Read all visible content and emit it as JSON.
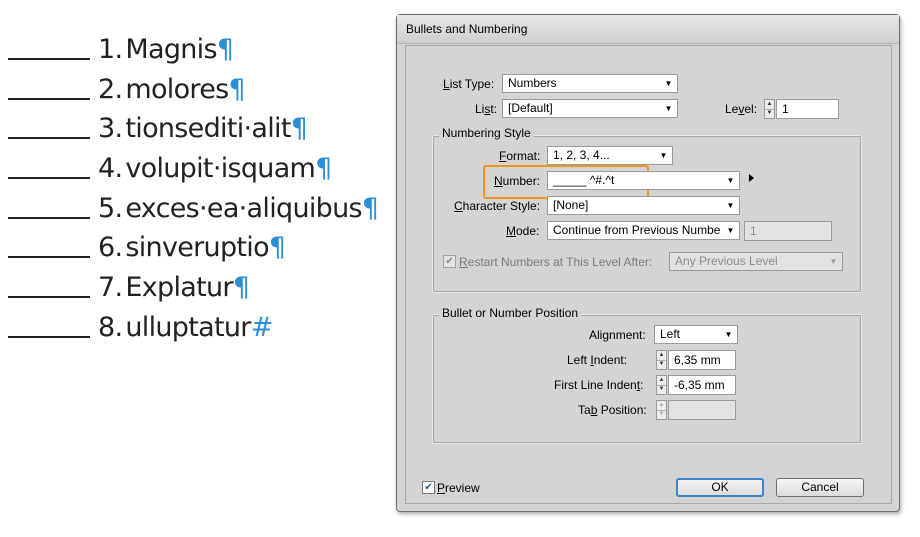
{
  "list": {
    "items": [
      {
        "number": "1.",
        "text": "Magnis",
        "end_mark": "¶"
      },
      {
        "number": "2.",
        "text": "molores",
        "end_mark": "¶"
      },
      {
        "number": "3.",
        "text": "tionsediti·alit",
        "end_mark": "¶"
      },
      {
        "number": "4.",
        "text": "volupit·isquam",
        "end_mark": "¶"
      },
      {
        "number": "5.",
        "text": "exces·ea·aliquibus",
        "end_mark": "¶"
      },
      {
        "number": "6.",
        "text": "sinveruptio",
        "end_mark": "¶"
      },
      {
        "number": "7.",
        "text": "Explatur",
        "end_mark": "¶"
      },
      {
        "number": "8.",
        "text": "ulluptatur",
        "end_mark": "#"
      }
    ]
  },
  "dialog": {
    "title": "Bullets and Numbering",
    "list_type": {
      "label_u": "L",
      "label_rest": "ist Type:",
      "value": "Numbers"
    },
    "list": {
      "label_pre": "Li",
      "label_u": "s",
      "label_rest": "t:",
      "value": "[Default]"
    },
    "level": {
      "label_pre": "Le",
      "label_u": "v",
      "label_rest": "el:",
      "value": "1"
    },
    "numbering_style": {
      "title": "Numbering Style",
      "format": {
        "label_u": "F",
        "label_rest": "ormat:",
        "value": "1, 2, 3, 4..."
      },
      "number": {
        "label_u": "N",
        "label_rest": "umber:",
        "value": "_____ ^#.^t"
      },
      "character_style": {
        "label_u": "C",
        "label_rest": "haracter Style:",
        "value": "[None]"
      },
      "mode": {
        "label_u": "M",
        "label_rest": "ode:",
        "value": "Continue from Previous Numbe",
        "start_value": "1"
      },
      "restart": {
        "label_pre": "",
        "label_u": "R",
        "label_rest": "estart Numbers at This Level After:",
        "value": "Any Previous Level",
        "checked": true
      }
    },
    "position": {
      "title": "Bullet or Number Position",
      "alignment": {
        "label_pre": "Ali",
        "label_u": "g",
        "label_rest": "nment:",
        "value": "Left"
      },
      "left_indent": {
        "label_pre": "Left ",
        "label_u": "I",
        "label_rest": "ndent:",
        "value": "6,35 mm"
      },
      "first_line_indent": {
        "label_pre": "First Line Inden",
        "label_u": "t",
        "label_rest": ":",
        "value": "-6,35 mm"
      },
      "tab_position": {
        "label_pre": "Ta",
        "label_u": "b",
        "label_rest": " Position:",
        "value": ""
      }
    },
    "preview": {
      "label_u": "P",
      "label_rest": "review",
      "checked": true
    },
    "ok_label": "OK",
    "cancel_label": "Cancel"
  },
  "colors": {
    "highlight": "#f0961e",
    "pilcrow": "#2a8fd6",
    "dialog_bg": "#d4d4d4"
  },
  "icons": {
    "dropdown": "chevron-down-icon",
    "spin": "spin-arrows-icon",
    "flyout": "flyout-triangle-icon",
    "check": "checkmark-icon"
  }
}
